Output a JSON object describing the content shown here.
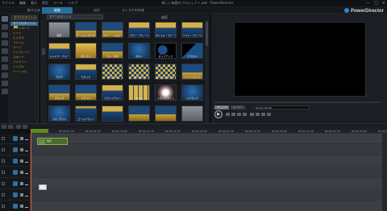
{
  "window": {
    "title": "新しい無題のプロジェクト.pds - PowerDirector",
    "menu": [
      "ファイル",
      "編集",
      "表示",
      "再生",
      "ツール",
      "ヘルプ"
    ],
    "controls": [
      "－",
      "□",
      "×"
    ]
  },
  "brand": {
    "name": "PowerDirector",
    "accent": "#2e8ad0"
  },
  "mode_tabs": [
    {
      "label": "取り込み",
      "active": false
    },
    {
      "label": "編集",
      "active": true
    },
    {
      "label": "出力",
      "active": false
    },
    {
      "label": "ディスクの作成",
      "active": false
    }
  ],
  "category_panel": {
    "dropdown": "すべてのタイトル",
    "items": [
      {
        "label": "すべてのタイトル",
        "selected": true
      },
      {
        "label": "ダウンロード",
        "selected": false
      },
      {
        "label": "ヒント",
        "selected": false
      },
      {
        "label": "ビジネス",
        "selected": false
      },
      {
        "label": "フレーム",
        "selected": false
      },
      {
        "label": "ライト",
        "selected": false
      },
      {
        "label": "テンプレート",
        "selected": false
      },
      {
        "label": "スポーツ",
        "selected": false
      },
      {
        "label": "ファミリー",
        "selected": false
      },
      {
        "label": "シンプル",
        "selected": false
      },
      {
        "label": "ソーシャル",
        "selected": false
      }
    ]
  },
  "library": {
    "dropdown": "すべてのタイトル",
    "search_label": "検索",
    "tiles": [
      {
        "caption": "既定",
        "style": "gray-a"
      },
      {
        "caption": "モーションポスター",
        "style": "blue-gold"
      },
      {
        "caption": "ブルー・イエロー",
        "style": "blue-gold"
      },
      {
        "caption": "ブルー・プレーン",
        "style": "gold-blue"
      },
      {
        "caption": "タイトル・プレーン",
        "style": "gold-blue"
      },
      {
        "caption": "ソフト・プレーン",
        "style": "gold-blue"
      },
      {
        "caption": "シャドウ・ブルー",
        "style": "gold-blue"
      },
      {
        "caption": "ボックス",
        "style": "gold-a"
      },
      {
        "caption": "ブルーの帯",
        "style": "blue-gold"
      },
      {
        "caption": "ボタン",
        "style": "blue-a"
      },
      {
        "caption": "ポップアップ",
        "style": "black-blob"
      },
      {
        "caption": "ピクセル",
        "style": "black-blue"
      },
      {
        "caption": "アクア",
        "style": "blue-a"
      },
      {
        "caption": "モザイク",
        "style": "gold-blue"
      },
      {
        "caption": "グリッド",
        "style": "gold-checker"
      },
      {
        "caption": "グリッド2",
        "style": "gold-checker"
      },
      {
        "caption": "グリッドライト",
        "style": "gold-checker"
      },
      {
        "caption": "ソフトスライド",
        "style": "blue-gold"
      },
      {
        "caption": "ブロック",
        "style": "blue-gold"
      },
      {
        "caption": "スライド",
        "style": "blue-gold"
      },
      {
        "caption": "スライドライン",
        "style": "gold-blue"
      },
      {
        "caption": "タイル",
        "style": "gold-grid"
      },
      {
        "caption": "スポットライト",
        "style": "white-glow"
      },
      {
        "caption": "ストライプ",
        "style": "blue-a"
      },
      {
        "caption": "ブルーライト",
        "style": "blue-a"
      },
      {
        "caption": "ゴールドライン",
        "style": "gold-line"
      },
      {
        "caption": "",
        "style": "gold-blue"
      },
      {
        "caption": "",
        "style": "blue-gold"
      },
      {
        "caption": "",
        "style": "blue-gold"
      },
      {
        "caption": "",
        "style": "gray-a"
      }
    ]
  },
  "preview": {
    "modes": [
      {
        "label": "クリップ",
        "active": true
      },
      {
        "label": "ムービー",
        "active": false
      }
    ],
    "timecode": "00;00;00;00"
  },
  "timeline": {
    "ticks": [
      "00;00;00;00",
      "00;00;03;10",
      "00;00;06;20",
      "00;00;10;00",
      "00;00;13;10",
      "00;00;16;20",
      "00;00;20;00",
      "00;00;23;10",
      "00;00;26;20",
      "00;00;30;00",
      "00;00;33;10",
      "00;00;36;20",
      "00;00;40;00",
      "00;00;43;10"
    ],
    "clip_label": "既定"
  },
  "colors": {
    "accent": "#2a6f9c",
    "gold": "#c9a13a",
    "clip": "#4a6a2e",
    "playhead": "#e05a3a"
  }
}
